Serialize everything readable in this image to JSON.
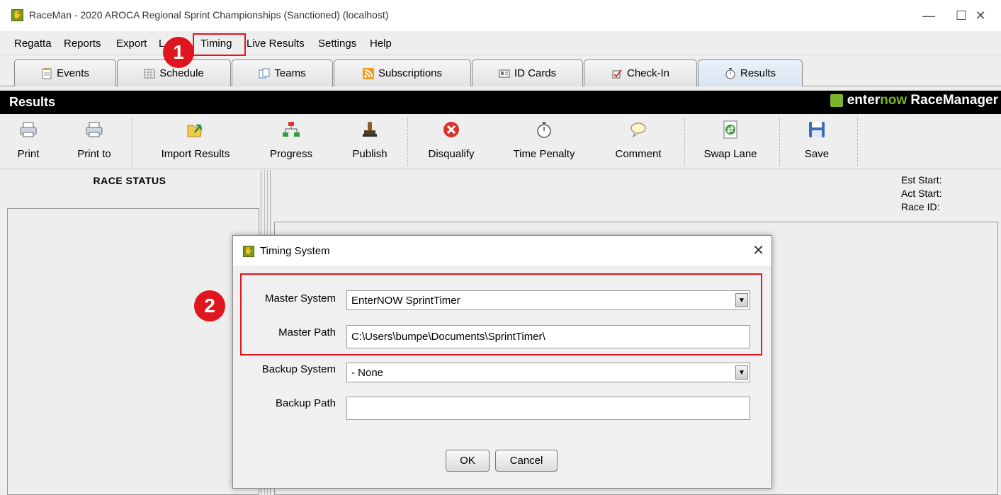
{
  "window": {
    "title": "RaceMan - 2020 AROCA Regional Sprint Championships (Sanctioned) (localhost)"
  },
  "menu": [
    "Regatta",
    "Reports",
    "Export",
    "L",
    "Timing",
    "Live Results",
    "Settings",
    "Help"
  ],
  "tabs": [
    "Events",
    "Schedule",
    "Teams",
    "Subscriptions",
    "ID Cards",
    "Check-In",
    "Results"
  ],
  "header": {
    "title": "Results",
    "brand_a": "enter",
    "brand_b": "now",
    "brand_c": " RaceManager"
  },
  "toolbar": [
    "Print",
    "Print to",
    "Import Results",
    "Progress",
    "Publish",
    "Disqualify",
    "Time Penalty",
    "Comment",
    "Swap Lane",
    "Save"
  ],
  "left": {
    "race_status": "RACE STATUS"
  },
  "right": {
    "est_start": "Est Start:",
    "act_start": "Act Start:",
    "race_id": "Race ID:"
  },
  "dialog": {
    "title": "Timing System",
    "master_system_label": "Master System",
    "master_system_value": "EnterNOW SprintTimer",
    "master_path_label": "Master Path",
    "master_path_value": "C:\\Users\\bumpe\\Documents\\SprintTimer\\",
    "backup_system_label": "Backup System",
    "backup_system_value": "- None",
    "backup_path_label": "Backup Path",
    "backup_path_value": "",
    "ok": "OK",
    "cancel": "Cancel"
  },
  "annotations": {
    "step1": "1",
    "step2": "2"
  },
  "colors": {
    "accent_red": "#e0161e",
    "brand_green": "#7fb32a"
  }
}
